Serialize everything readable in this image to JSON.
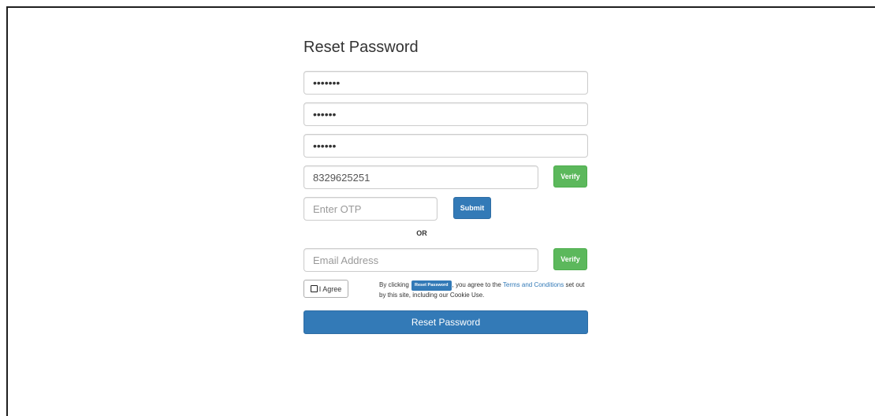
{
  "form": {
    "title": "Reset Password",
    "current_password_value": "•••••••",
    "new_password_value": "••••••",
    "confirm_password_value": "••••••",
    "mobile_value": "8329625251",
    "mobile_verify_label": "Verify",
    "otp_placeholder": "Enter OTP",
    "otp_submit_label": "Submit",
    "or_label": "OR",
    "email_placeholder": "Email Address",
    "email_verify_label": "Verify",
    "agree_label": "I Agree",
    "terms_prefix": "By clicking",
    "terms_badge": "Reset Password",
    "terms_middle": ", you agree to the",
    "terms_link": "Terms and Conditions",
    "terms_suffix": "set out by this site, including our Cookie Use.",
    "submit_label": "Reset Password"
  },
  "colors": {
    "primary": "#337ab7",
    "success": "#5cb85c",
    "border": "#cccccc"
  }
}
